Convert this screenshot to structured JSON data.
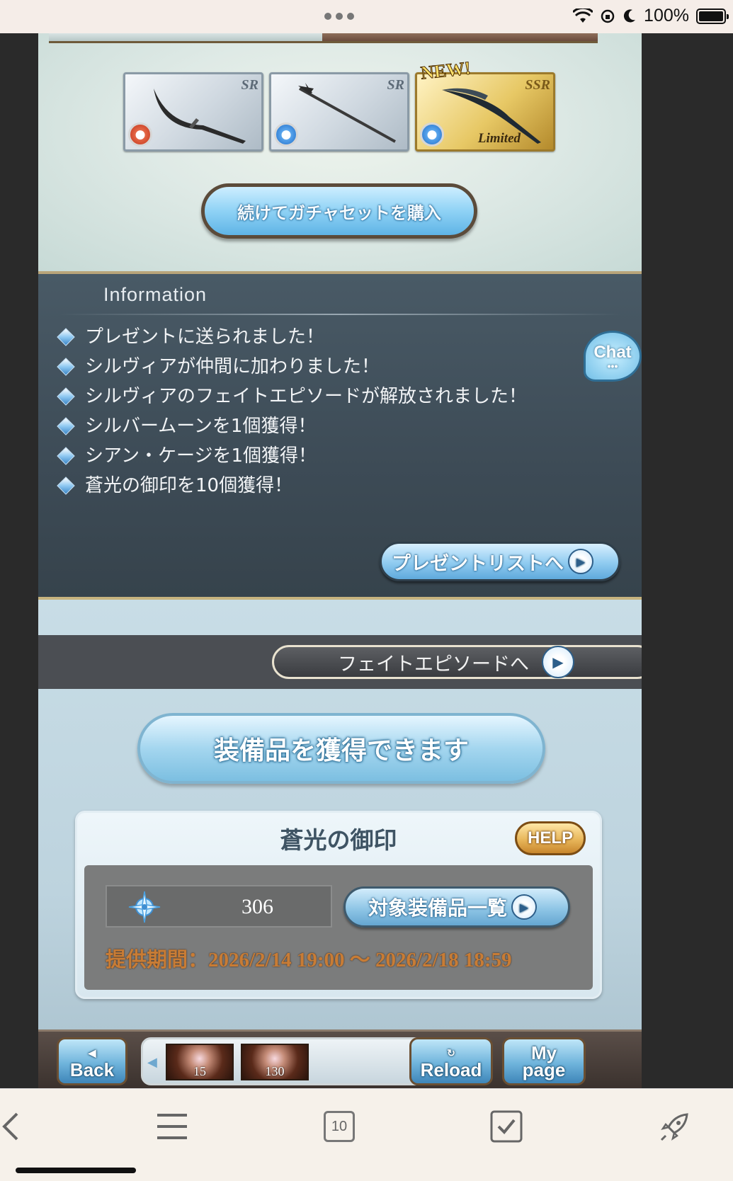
{
  "status": {
    "battery_text": "100%"
  },
  "result": {
    "cards": [
      {
        "rarity": "SR",
        "element": "fire"
      },
      {
        "rarity": "SR",
        "element": "water"
      },
      {
        "rarity": "SSR",
        "element": "water",
        "badge": "NEW!",
        "label": "Limited"
      }
    ],
    "buy_again_label": "続けてガチャセットを購入"
  },
  "information": {
    "title": "Information",
    "items": [
      "プレゼントに送られました！",
      "シルヴィアが仲間に加わりました！",
      "シルヴィアのフェイトエピソードが解放されました！",
      "シルバームーンを1個獲得！",
      "シアン・ケージを1個獲得！",
      "蒼光の御印を10個獲得！"
    ],
    "present_button": "プレゼントリストへ"
  },
  "fate": {
    "button": "フェイトエピソードへ"
  },
  "equip": {
    "banner": "装備品を獲得できます"
  },
  "seal": {
    "title": "蒼光の御印",
    "help": "HELP",
    "count": "306",
    "target_button": "対象装備品一覧",
    "period": "提供期間：2026/2/14 19:00 〜 2026/2/18 18:59"
  },
  "chat": {
    "label": "Chat",
    "dots": "•••"
  },
  "game_nav": {
    "back_glyph": "◀",
    "back": "Back",
    "reload_glyph": "↻",
    "reload": "Reload",
    "mypage_line1": "My",
    "mypage_line2": "page",
    "items": [
      {
        "count": "15"
      },
      {
        "count": "130"
      }
    ]
  },
  "browser": {
    "tab_count": "10"
  },
  "colors": {
    "accent_blue": "#8fcbf0",
    "info_bg": "#3d4b56",
    "gold": "#c87c35"
  }
}
